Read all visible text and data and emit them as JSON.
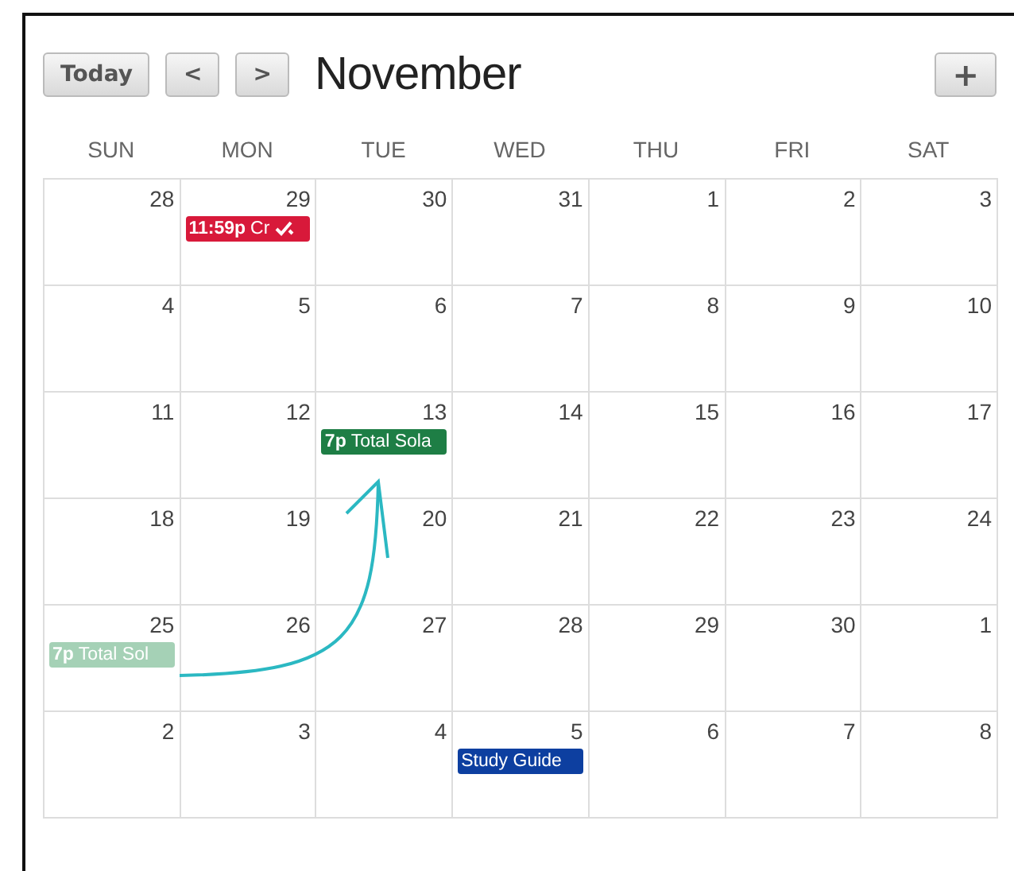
{
  "toolbar": {
    "today": "Today",
    "prev": "<",
    "next": ">",
    "title": "November",
    "add": "+"
  },
  "weekdays": [
    "SUN",
    "MON",
    "TUE",
    "WED",
    "THU",
    "FRI",
    "SAT"
  ],
  "weeks": [
    {
      "days": [
        {
          "day": "28"
        },
        {
          "day": "29",
          "events": [
            {
              "time": "11:59p",
              "title": "Cr",
              "color": "#d8193a",
              "done": true
            }
          ]
        },
        {
          "day": "30"
        },
        {
          "day": "31"
        },
        {
          "day": "1"
        },
        {
          "day": "2"
        },
        {
          "day": "3"
        }
      ]
    },
    {
      "days": [
        {
          "day": "4"
        },
        {
          "day": "5"
        },
        {
          "day": "6"
        },
        {
          "day": "7"
        },
        {
          "day": "8"
        },
        {
          "day": "9"
        },
        {
          "day": "10"
        }
      ]
    },
    {
      "days": [
        {
          "day": "11"
        },
        {
          "day": "12"
        },
        {
          "day": "13",
          "events": [
            {
              "time": "7p",
              "title": "Total Sola",
              "color": "#1e7e45",
              "done": false
            }
          ]
        },
        {
          "day": "14"
        },
        {
          "day": "15"
        },
        {
          "day": "16"
        },
        {
          "day": "17"
        }
      ]
    },
    {
      "days": [
        {
          "day": "18"
        },
        {
          "day": "19"
        },
        {
          "day": "20"
        },
        {
          "day": "21"
        },
        {
          "day": "22"
        },
        {
          "day": "23"
        },
        {
          "day": "24"
        }
      ]
    },
    {
      "days": [
        {
          "day": "25",
          "events": [
            {
              "time": "7p",
              "title": "Total Sol",
              "color": "#a5d1b6",
              "done": false
            }
          ]
        },
        {
          "day": "26"
        },
        {
          "day": "27"
        },
        {
          "day": "28"
        },
        {
          "day": "29"
        },
        {
          "day": "30"
        },
        {
          "day": "1"
        }
      ]
    },
    {
      "days": [
        {
          "day": "2"
        },
        {
          "day": "3"
        },
        {
          "day": "4"
        },
        {
          "day": "5",
          "events": [
            {
              "title": "Study Guide",
              "color": "#0d3fa0",
              "done": false
            }
          ]
        },
        {
          "day": "6"
        },
        {
          "day": "7"
        },
        {
          "day": "8"
        }
      ]
    }
  ]
}
